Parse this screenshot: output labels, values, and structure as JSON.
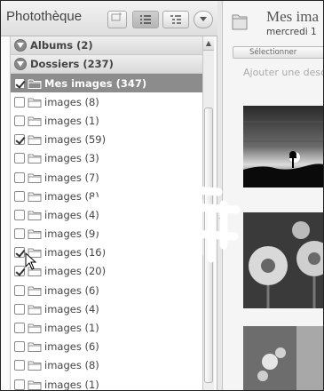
{
  "header": {
    "title": "Photothèque",
    "add_icon": "add-folder-icon",
    "view_list_icon": "list-view-icon",
    "view_detail_icon": "detail-view-icon",
    "menu_icon": "chevron-down-icon"
  },
  "tree": {
    "sections": [
      {
        "label": "Albums (2)",
        "icon": "collapse-icon"
      },
      {
        "label": "Dossiers (237)",
        "icon": "collapse-icon"
      }
    ],
    "items": [
      {
        "label": "Mes images (347)",
        "checked": true,
        "selected": true
      },
      {
        "label": "images (8)",
        "checked": false
      },
      {
        "label": "images (1)",
        "checked": false
      },
      {
        "label": "images (59)",
        "checked": true
      },
      {
        "label": "images (3)",
        "checked": false
      },
      {
        "label": "images (7)",
        "checked": false
      },
      {
        "label": "images (8)",
        "checked": false
      },
      {
        "label": "images (4)",
        "checked": false
      },
      {
        "label": "images (9)",
        "checked": false
      },
      {
        "label": "images (16)",
        "checked": true
      },
      {
        "label": "images (20)",
        "checked": true
      },
      {
        "label": "images (6)",
        "checked": false
      },
      {
        "label": "images (4)",
        "checked": false
      },
      {
        "label": "images (1)",
        "checked": false
      },
      {
        "label": "images (6)",
        "checked": false
      },
      {
        "label": "images (8)",
        "checked": false
      },
      {
        "label": "images (1)",
        "checked": false
      }
    ]
  },
  "content": {
    "title": "Mes ima",
    "date": "mercredi 1",
    "select_label": "Sélectionner",
    "description_placeholder": "Ajouter une desc"
  },
  "colors": {
    "selected_row": "#8c8c8c",
    "panel_bg": "#f5f5f5"
  }
}
